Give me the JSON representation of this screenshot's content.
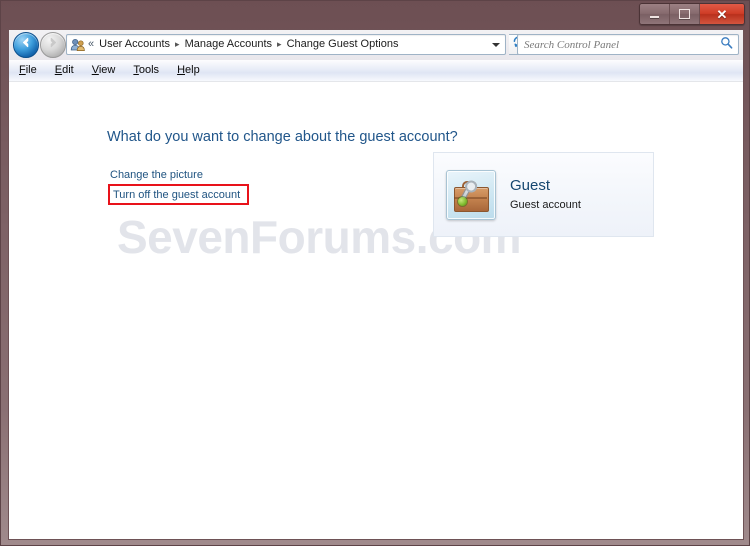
{
  "window": {
    "controls": {
      "minimize_label": "Minimize",
      "maximize_label": "Maximize",
      "close_label": "Close"
    }
  },
  "addressbar": {
    "back_label": "Back",
    "forward_label": "Forward",
    "recent_pages_label": "Recent pages",
    "crumb_chevron": "«",
    "crumbs": [
      {
        "label": "User Accounts"
      },
      {
        "label": "Manage Accounts"
      },
      {
        "label": "Change Guest Options"
      }
    ],
    "separator": "▸",
    "refresh_label": "Refresh"
  },
  "search": {
    "placeholder": "Search Control Panel",
    "value": ""
  },
  "menubar": {
    "items": [
      {
        "label": "File"
      },
      {
        "label": "Edit"
      },
      {
        "label": "View"
      },
      {
        "label": "Tools"
      },
      {
        "label": "Help"
      }
    ]
  },
  "main": {
    "heading": "What do you want to change about the guest account?",
    "links": [
      {
        "label": "Change the picture"
      },
      {
        "label": "Turn off the guest account"
      }
    ],
    "account": {
      "name": "Guest",
      "description": "Guest account",
      "icon": "guest-suitcase-icon"
    },
    "highlight_color": "#e8121a"
  },
  "watermark": {
    "text": "SevenForums.com"
  },
  "colors": {
    "frame": "#7d6165",
    "title_text": "#ffffff",
    "heading_blue": "#21568a",
    "link_blue": "#1f5380",
    "highlight_red": "#e8121a",
    "close_button": "#cf3c26"
  }
}
